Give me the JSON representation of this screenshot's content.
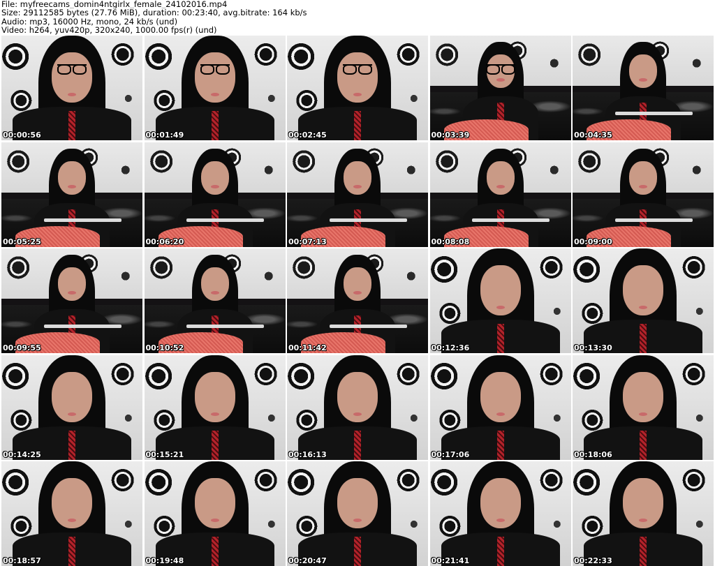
{
  "header": {
    "file": "File: myfreecams_domin4ntgirlx_female_24102016.mp4",
    "size": "Size: 29112585 bytes (27.76 MiB), duration: 00:23:40, avg.bitrate: 164 kb/s",
    "audio": "Audio: mp3, 16000 Hz, mono, 24 kb/s (und)",
    "video": "Video: h264, yuv420p, 320x240, 1000.00 fps(r) (und)"
  },
  "thumbnails": [
    {
      "timestamp": "00:00:56"
    },
    {
      "timestamp": "00:01:49"
    },
    {
      "timestamp": "00:02:45"
    },
    {
      "timestamp": "00:03:39"
    },
    {
      "timestamp": "00:04:35"
    },
    {
      "timestamp": "00:05:25"
    },
    {
      "timestamp": "00:06:20"
    },
    {
      "timestamp": "00:07:13"
    },
    {
      "timestamp": "00:08:08"
    },
    {
      "timestamp": "00:09:00"
    },
    {
      "timestamp": "00:09:55"
    },
    {
      "timestamp": "00:10:52"
    },
    {
      "timestamp": "00:11:42"
    },
    {
      "timestamp": "00:12:36"
    },
    {
      "timestamp": "00:13:30"
    },
    {
      "timestamp": "00:14:25"
    },
    {
      "timestamp": "00:15:21"
    },
    {
      "timestamp": "00:16:13"
    },
    {
      "timestamp": "00:17:06"
    },
    {
      "timestamp": "00:18:06"
    },
    {
      "timestamp": "00:18:57"
    },
    {
      "timestamp": "00:19:48"
    },
    {
      "timestamp": "00:20:47"
    },
    {
      "timestamp": "00:21:41"
    },
    {
      "timestamp": "00:22:33"
    }
  ]
}
